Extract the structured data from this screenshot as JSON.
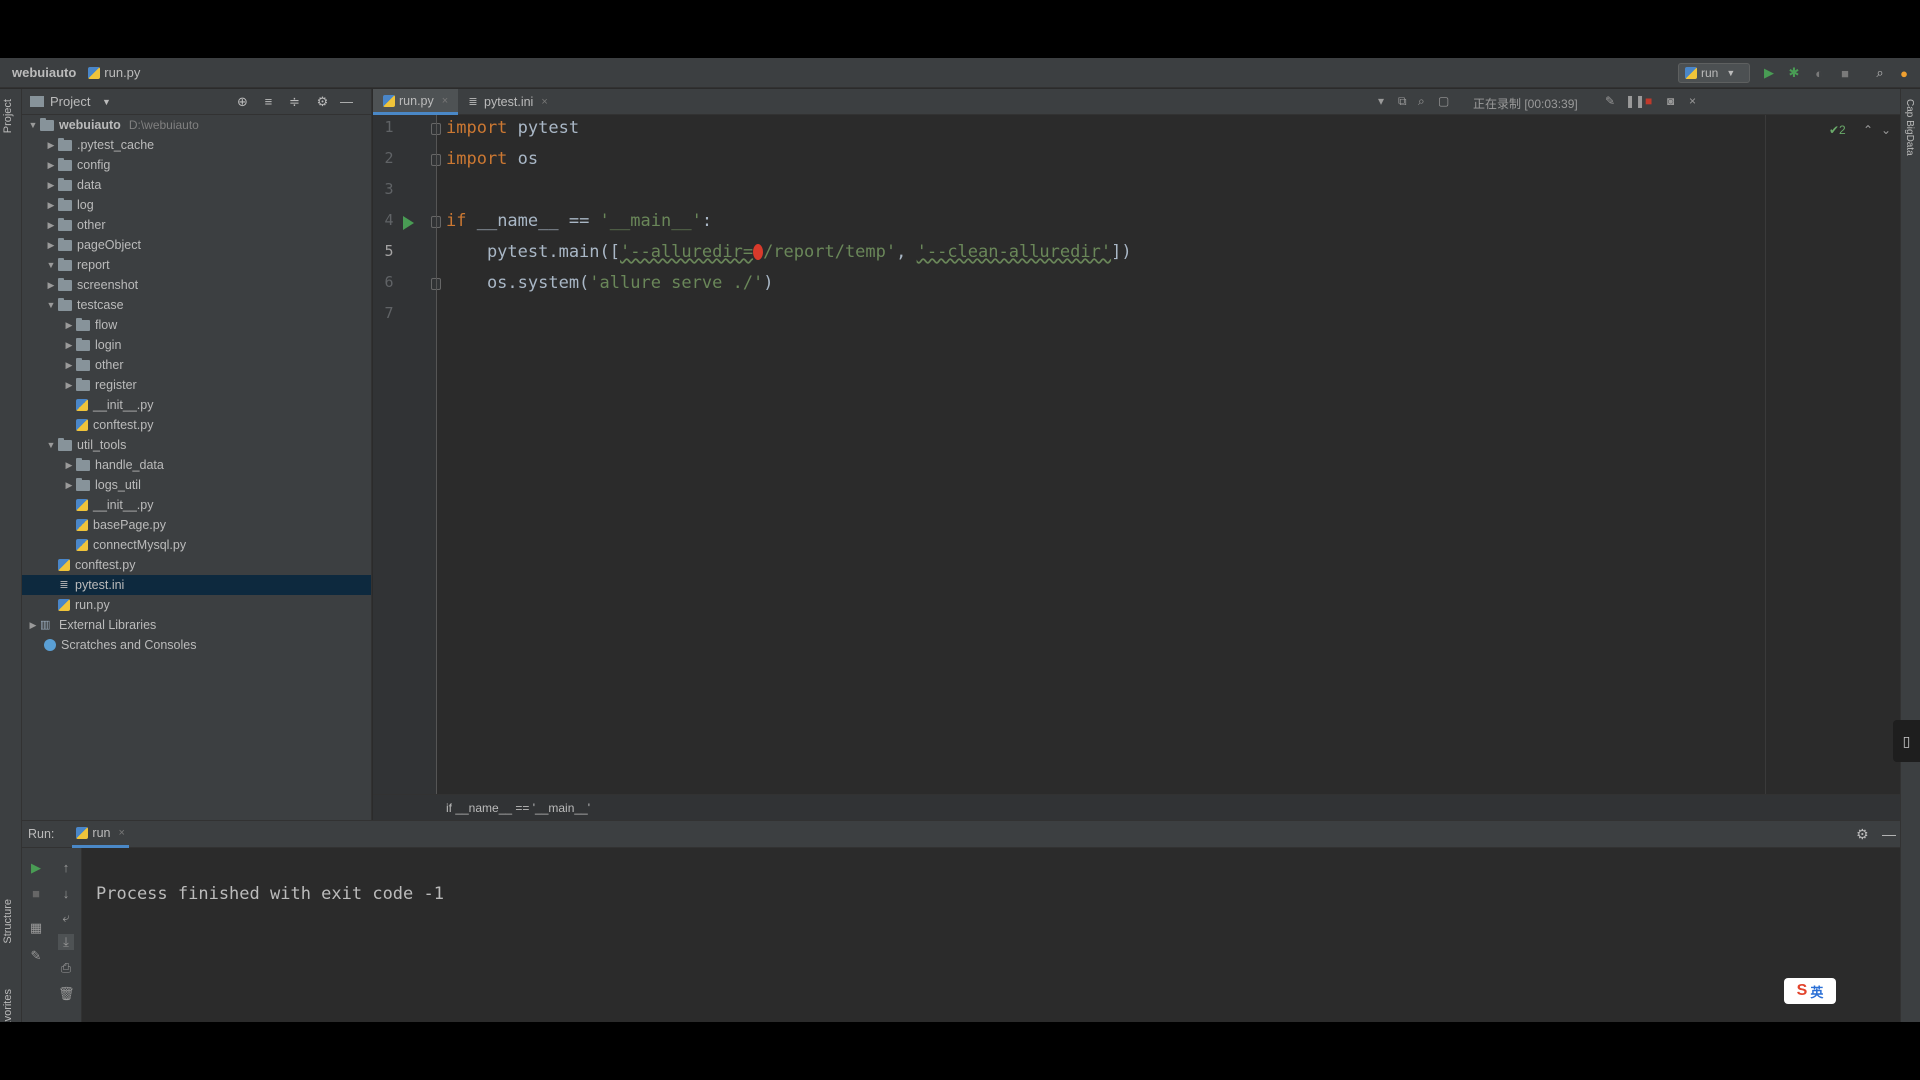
{
  "navbar": {
    "project": "webuiauto",
    "file": "run.py",
    "run_config": "run"
  },
  "left_strip": {
    "project_label": "Project",
    "structure_label": "Structure",
    "favorites_label": "Favorites"
  },
  "right_strip": {
    "label": "Cap BigData"
  },
  "project_panel": {
    "title": "Project",
    "root": {
      "name": "webuiauto",
      "path": "D:\\webuiauto"
    },
    "items": [
      {
        "label": ".pytest_cache",
        "type": "folder",
        "depth": 1,
        "expanded": false
      },
      {
        "label": "config",
        "type": "folder",
        "depth": 1,
        "expanded": false
      },
      {
        "label": "data",
        "type": "folder",
        "depth": 1,
        "expanded": false
      },
      {
        "label": "log",
        "type": "folder",
        "depth": 1,
        "expanded": false
      },
      {
        "label": "other",
        "type": "folder",
        "depth": 1,
        "expanded": false
      },
      {
        "label": "pageObject",
        "type": "folder",
        "depth": 1,
        "expanded": false
      },
      {
        "label": "report",
        "type": "folder",
        "depth": 1,
        "expanded": true
      },
      {
        "label": "screenshot",
        "type": "folder",
        "depth": 1,
        "expanded": false
      },
      {
        "label": "testcase",
        "type": "folder",
        "depth": 1,
        "expanded": true
      },
      {
        "label": "flow",
        "type": "folder",
        "depth": 2,
        "expanded": false
      },
      {
        "label": "login",
        "type": "folder",
        "depth": 2,
        "expanded": false
      },
      {
        "label": "other",
        "type": "folder",
        "depth": 2,
        "expanded": false
      },
      {
        "label": "register",
        "type": "folder",
        "depth": 2,
        "expanded": false
      },
      {
        "label": "__init__.py",
        "type": "py",
        "depth": 2
      },
      {
        "label": "conftest.py",
        "type": "py",
        "depth": 2
      },
      {
        "label": "util_tools",
        "type": "folder",
        "depth": 1,
        "expanded": true
      },
      {
        "label": "handle_data",
        "type": "folder",
        "depth": 2,
        "expanded": false
      },
      {
        "label": "logs_util",
        "type": "folder",
        "depth": 2,
        "expanded": false
      },
      {
        "label": "__init__.py",
        "type": "py",
        "depth": 2
      },
      {
        "label": "basePage.py",
        "type": "py",
        "depth": 2
      },
      {
        "label": "connectMysql.py",
        "type": "py",
        "depth": 2
      },
      {
        "label": "conftest.py",
        "type": "py",
        "depth": 1
      },
      {
        "label": "pytest.ini",
        "type": "ini",
        "depth": 1,
        "selected": true
      },
      {
        "label": "run.py",
        "type": "py",
        "depth": 1
      }
    ],
    "external_libraries": "External Libraries",
    "scratches": "Scratches and Consoles"
  },
  "tabs": [
    {
      "label": "run.py",
      "active": true
    },
    {
      "label": "pytest.ini",
      "active": false
    }
  ],
  "recording_status": "正在录制 [00:03:39]",
  "inspections": "✔2",
  "editor": {
    "line_numbers": [
      "1",
      "2",
      "3",
      "4",
      "5",
      "6",
      "7"
    ],
    "current_line": 5,
    "lines": [
      {
        "kw": "import",
        "rest": " pytest"
      },
      {
        "kw": "import",
        "rest": " os"
      },
      {
        "kw": "",
        "rest": ""
      },
      {
        "kw": "if",
        "rest": " __name__ == ",
        "str": "'__main__'",
        "tail": ":"
      },
      {
        "pre": "    pytest.main([",
        "s1": "'--alluredir=",
        "s1b": "/report/temp'",
        "mid": ", ",
        "s2": "'--clean-alluredir'",
        "tail": "])"
      },
      {
        "pre": "    os.system(",
        "s1": "'allure serve ./'",
        "tail": ")"
      },
      {
        "kw": "",
        "rest": ""
      }
    ]
  },
  "breadcrumb": "if __name__ == '__main__'",
  "run_panel": {
    "label": "Run:",
    "tab": "run",
    "output": "Process finished with exit code -1"
  },
  "ime": {
    "logo": "S",
    "lang": "英"
  },
  "colors": {
    "keyword": "#cc7832",
    "string": "#6a8759",
    "identifier": "#a9b7c6",
    "selection": "#0d293e",
    "accent": "#4a88c7",
    "run_green": "#499c54"
  }
}
